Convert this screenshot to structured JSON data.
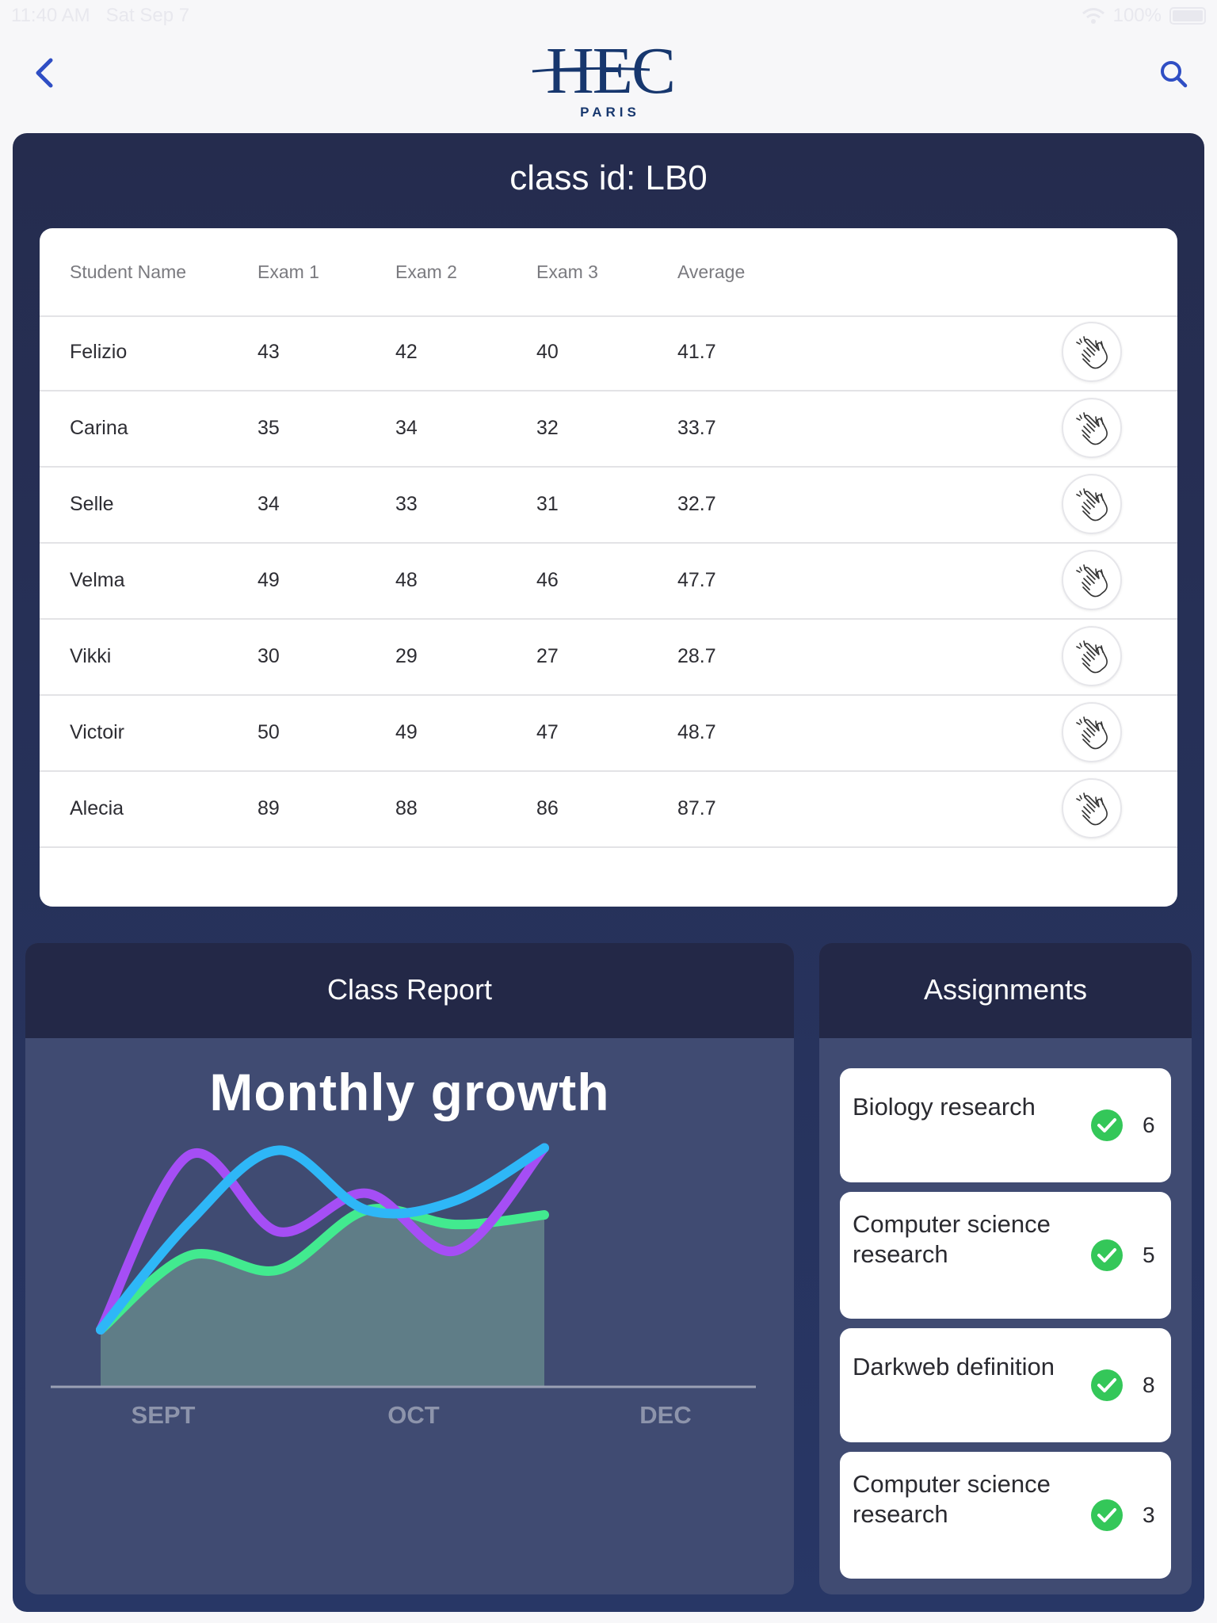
{
  "status_bar": {
    "time": "11:40 AM",
    "date": "Sat Sep 7",
    "battery": "100%"
  },
  "header": {
    "logo_main": "HEC",
    "logo_sub": "PARIS",
    "back_icon": "chevron-left-icon",
    "search_icon": "search-icon"
  },
  "class_panel": {
    "title": "class id: LB0"
  },
  "table": {
    "columns": [
      "Student Name",
      "Exam 1",
      "Exam 2",
      "Exam 3",
      "Average"
    ],
    "rows": [
      {
        "name": "Felizio",
        "exam1": "43",
        "exam2": "42",
        "exam3": "40",
        "average": "41.7"
      },
      {
        "name": "Carina",
        "exam1": "35",
        "exam2": "34",
        "exam3": "32",
        "average": "33.7"
      },
      {
        "name": "Selle",
        "exam1": "34",
        "exam2": "33",
        "exam3": "31",
        "average": "32.7"
      },
      {
        "name": "Velma",
        "exam1": "49",
        "exam2": "48",
        "exam3": "46",
        "average": "47.7"
      },
      {
        "name": "Vikki",
        "exam1": "30",
        "exam2": "29",
        "exam3": "27",
        "average": "28.7"
      },
      {
        "name": "Victoir",
        "exam1": "50",
        "exam2": "49",
        "exam3": "47",
        "average": "48.7"
      },
      {
        "name": "Alecia",
        "exam1": "89",
        "exam2": "88",
        "exam3": "86",
        "average": "87.7"
      }
    ],
    "row_action_icon": "clapping-hands-icon"
  },
  "report": {
    "header": "Class Report",
    "chart_title": "Monthly growth"
  },
  "chart_data": {
    "type": "line",
    "title": "Monthly growth",
    "x_labels": [
      "SEPT",
      "OCT",
      "DEC"
    ],
    "grid": false,
    "legend": "none",
    "series": [
      {
        "color": "#a54ef5",
        "values": [
          0.0,
          0.73,
          0.41,
          0.57,
          0.33,
          0.76
        ]
      },
      {
        "color": "#2eb7f7",
        "values": [
          0.0,
          0.45,
          0.75,
          0.5,
          0.54,
          0.76
        ]
      },
      {
        "color": "#42ea8f",
        "values": [
          0.0,
          0.31,
          0.25,
          0.5,
          0.44,
          0.48
        ],
        "filled": true
      }
    ]
  },
  "assignments": {
    "header": "Assignments",
    "check_icon": "check-circle-icon",
    "items": [
      {
        "title": "Biology research",
        "count": "6"
      },
      {
        "title": "Computer science research",
        "count": "5"
      },
      {
        "title": "Darkweb definition",
        "count": "8"
      },
      {
        "title": "Computer science research",
        "count": "3"
      }
    ]
  },
  "colors": {
    "panel_dark": "#252c4e",
    "logo_blue": "#17376e",
    "check_green": "#34c759",
    "accent_blue": "#2f4ec4"
  }
}
